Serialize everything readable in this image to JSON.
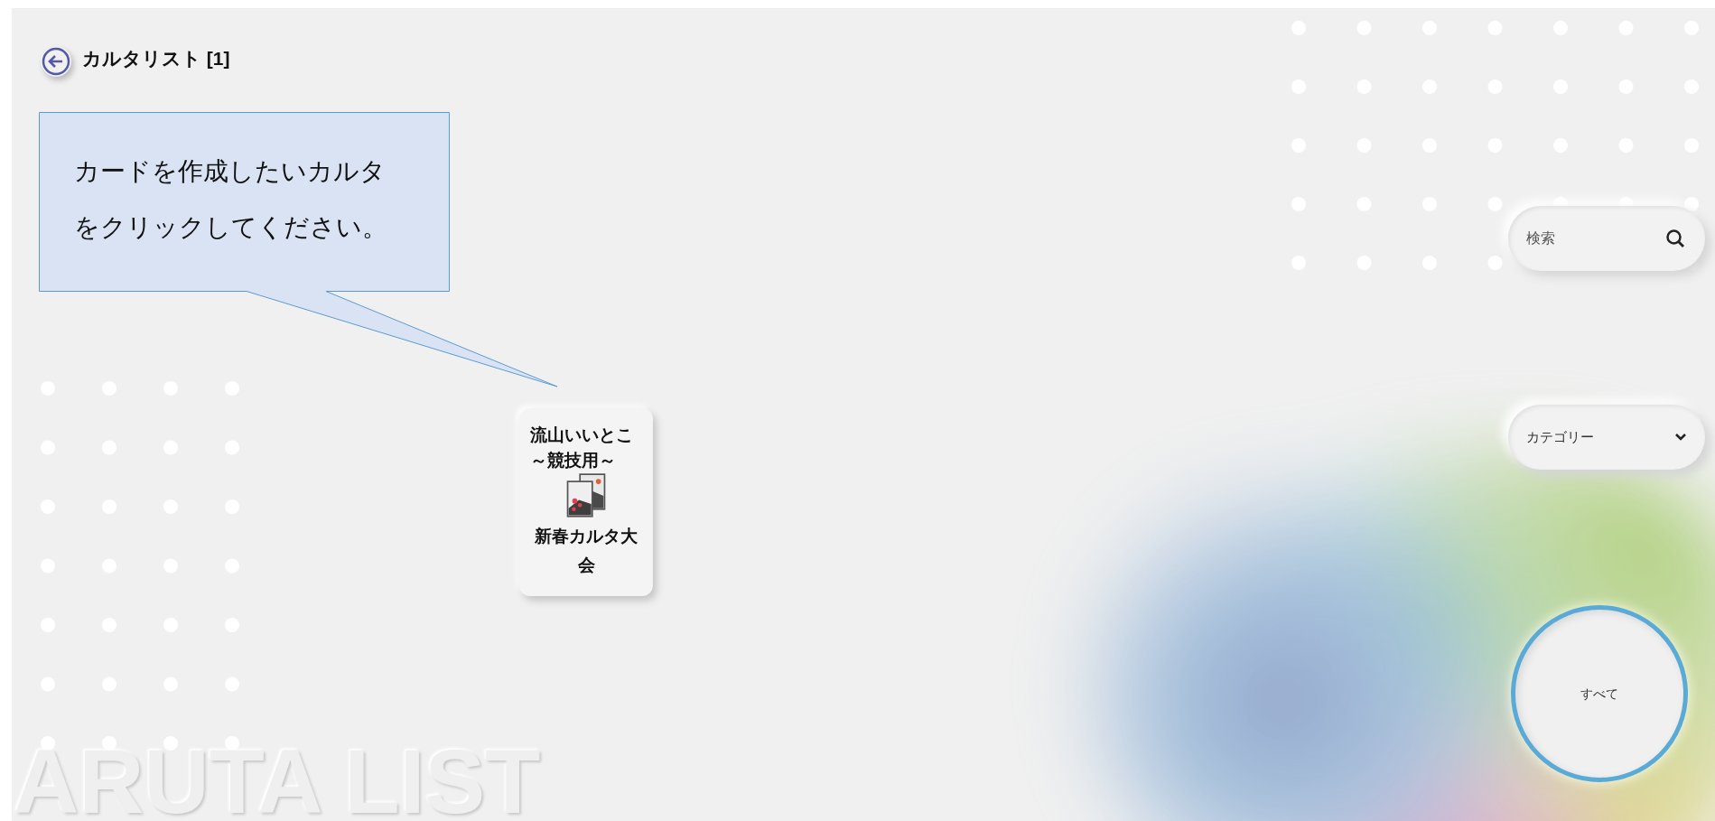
{
  "header": {
    "title": "カルタリスト [1]"
  },
  "callout": {
    "text": "カードを作成したいカルタをクリックしてください。"
  },
  "cards": [
    {
      "title": "流山いいとこ～競技用～",
      "event": "新春カルタ大会"
    }
  ],
  "search": {
    "placeholder": "検索"
  },
  "category": {
    "value": "カテゴリー"
  },
  "filter_button": {
    "label": "すべて"
  },
  "watermark": "ARUTA LIST"
}
